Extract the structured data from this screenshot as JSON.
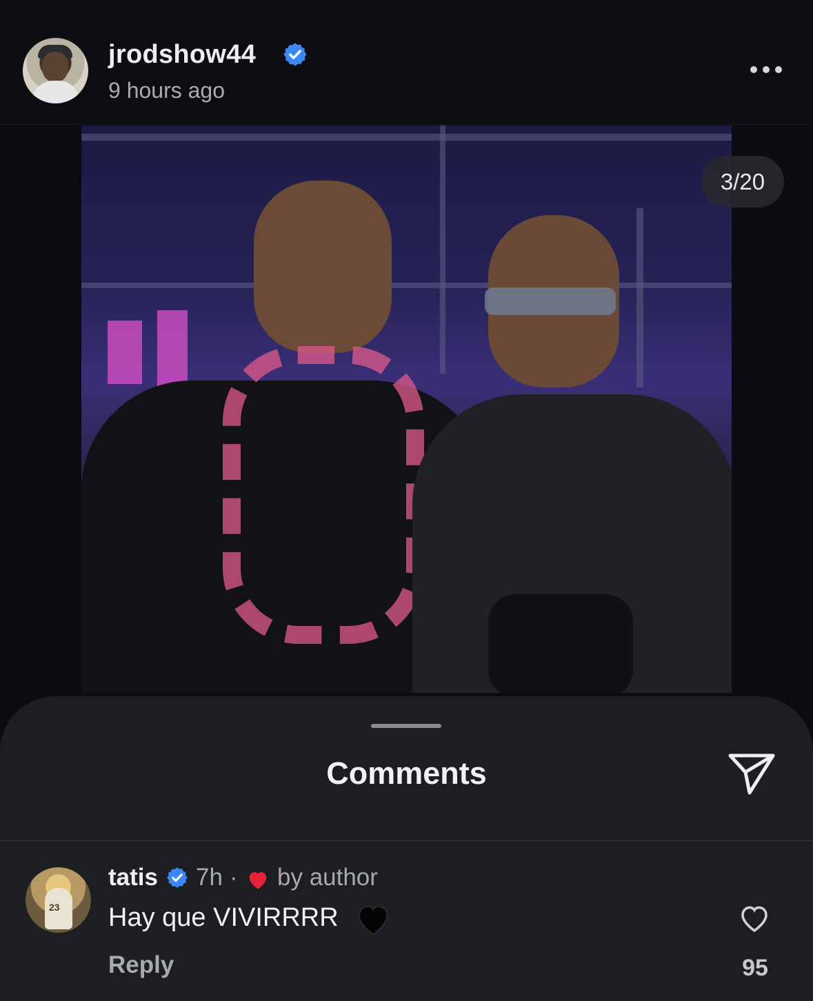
{
  "post": {
    "username": "jrodshow44",
    "time_ago": "9 hours ago",
    "verified_icon": "verified-badge-icon",
    "more_icon": "more-options-icon",
    "media_counter": "3/20"
  },
  "comments_sheet": {
    "title": "Comments",
    "share_icon": "send-icon"
  },
  "comments": [
    {
      "username": "tatis",
      "time": "7h",
      "separator": "·",
      "liked_by_author_label": "by author",
      "text": "Hay que VIVIRRRR",
      "emoji": "black-heart",
      "reply_label": "Reply",
      "like_count": "95"
    }
  ],
  "colors": {
    "background": "#0b0c10",
    "sheet": "#1d1e22",
    "verified_blue": "#3b87f3",
    "heart_red": "#e8223a",
    "muted_text": "#a7a9b0"
  }
}
